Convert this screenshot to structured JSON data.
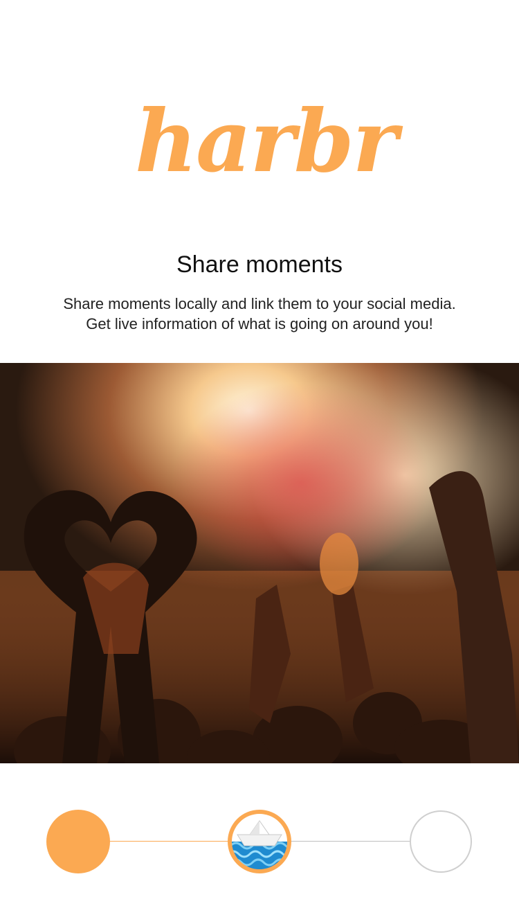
{
  "brand": {
    "logo_text": "harbr",
    "accent_color": "#fba952"
  },
  "onboarding": {
    "title": "Share moments",
    "description_lines": [
      "Share moments locally and link them to your social media.",
      "Get live information of what is going on around you!"
    ],
    "hero_image": "concert-crowd-heart-hands-photo"
  },
  "stepper": {
    "steps": [
      {
        "state": "completed"
      },
      {
        "state": "current",
        "icon": "paper-boat-on-waves-icon"
      },
      {
        "state": "upcoming"
      }
    ]
  }
}
